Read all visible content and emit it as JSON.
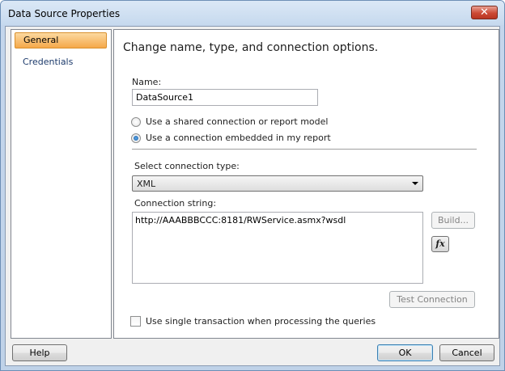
{
  "window": {
    "title": "Data Source Properties",
    "close_glyph": "✕"
  },
  "sidebar": {
    "items": [
      {
        "label": "General",
        "selected": true
      },
      {
        "label": "Credentials",
        "selected": false
      }
    ]
  },
  "main": {
    "heading": "Change name, type, and connection options.",
    "name_label": "Name:",
    "name_value": "DataSource1",
    "radio_shared": {
      "label": "Use a shared connection or report model",
      "checked": false
    },
    "radio_embedded": {
      "label": "Use a connection embedded in my report",
      "checked": true
    },
    "connection_type_label": "Select connection type:",
    "connection_type_value": "XML",
    "connection_string_label": "Connection string:",
    "connection_string_value": "http://AAABBBCCC:8181/RWService.asmx?wsdl",
    "build_button": "Build...",
    "fx_button": "fx",
    "test_connection_button": "Test Connection",
    "single_transaction": {
      "label": "Use single transaction when processing the queries",
      "checked": false
    }
  },
  "footer": {
    "help_button": "Help",
    "ok_button": "OK",
    "cancel_button": "Cancel"
  },
  "colors": {
    "selected_nav": "#f5a84a",
    "window_frame": "#c4d6ec",
    "close_button": "#cc4a35"
  },
  "icons": [
    "close-icon",
    "fx-icon",
    "dropdown-arrow-icon"
  ]
}
